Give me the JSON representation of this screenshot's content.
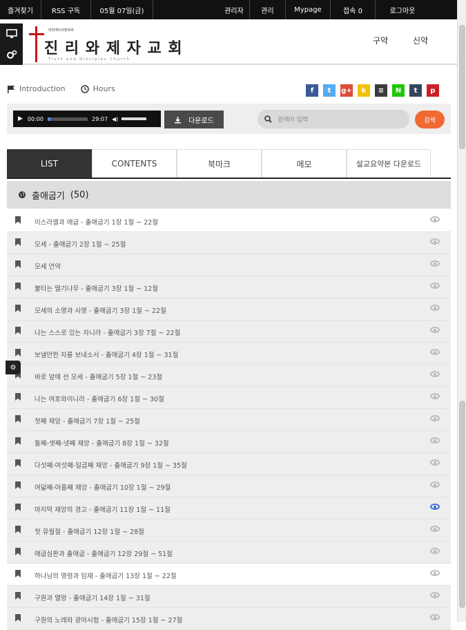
{
  "topbar": {
    "items": [
      "즐겨찾기",
      "RSS  구독",
      "05월  07일(금)",
      "관리자",
      "관리",
      "Mypage",
      "접속  0",
      "로그아웃"
    ]
  },
  "header": {
    "logo_small": "대한예수교장로회",
    "logo_name": "진 리 와 제 자 교 회",
    "logo_eng": "Truth and Disciples Church",
    "nav": [
      "구약",
      "신약"
    ]
  },
  "links": {
    "intro": "Introduction",
    "hours": "Hours"
  },
  "social": [
    {
      "icon": "facebook-icon",
      "glyph": "f",
      "color": "#3b5998"
    },
    {
      "icon": "twitter-icon",
      "glyph": "t",
      "color": "#55acee"
    },
    {
      "icon": "google-plus-icon",
      "glyph": "g+",
      "color": "#dd4b39"
    },
    {
      "icon": "kakao-icon",
      "glyph": "k",
      "color": "#f2c200"
    },
    {
      "icon": "band-icon",
      "glyph": "≡",
      "color": "#3b3b3b"
    },
    {
      "icon": "naver-icon",
      "glyph": "N",
      "color": "#1ec800"
    },
    {
      "icon": "tumblr-icon",
      "glyph": "t",
      "color": "#35465c"
    },
    {
      "icon": "pinterest-icon",
      "glyph": "p",
      "color": "#cb2027"
    }
  ],
  "player": {
    "current": "00:00",
    "duration": "29:07",
    "download_label": "다운로드"
  },
  "search": {
    "placeholder": "검색어 입력",
    "button": "검색"
  },
  "tabs": [
    "LIST",
    "CONTENTS",
    "북마크",
    "메모",
    "설교요약본 다운로드"
  ],
  "section": {
    "title": "출애굽기",
    "count": "(50)"
  },
  "items": [
    "이스라엘과 애굽  -  출애굽기  1장  1절  ~  22절",
    "모세  -  출애굽기  2장  1절  ~  25절",
    "모세  언약",
    "불타는  떨기나무  -  출애굽기  3장  1절  ~  12절",
    "모세의  소명과  사명  -  출애굽기  3장  1절  ~  22절",
    "나는  스스로  있는  자니라  -  출애굽기  3장  7절  ~  22절",
    "보낼만한  자를  보내소서  -  출애굽기  4장  1절  ~  31절",
    "바로  앞에  선  모세  -  출애굽기  5장  1절  ~  23절",
    "나는  여호와이니라  -  출애굽기  6장  1절  ~  30절",
    "첫째  재앙  -  출애굽기  7장  1절  ~  25절",
    "둘째-셋째-넷째  재앙  -  출애굽기  8장  1절  ~  32절",
    "다섯째-여섯째-일곱째  재앙  -  출애굽기  9장  1절  ~  35절",
    "여덟째-아홉째  재앙  -  출애굽기  10장  1절  ~  29절",
    "마지막  재앙의  경고  -  출애굽기  11장  1절  ~  11절",
    "첫  유월절  -  출애굽기  12장  1절  ~  28절",
    "애굽심판과  출애굽  -  출애굽기  12장  29절  ~  51절",
    "하나님의  명령과  임재  -  출애굽기  13장  1절  ~  22절",
    "구원과  멸망  -  출애굽기  14장  1절  ~  31절",
    "구원의  노래와  광야시험  -  출애굽기  15장  1절  ~  27절"
  ],
  "active_index": 13,
  "highlight_rows": [
    0,
    16
  ]
}
